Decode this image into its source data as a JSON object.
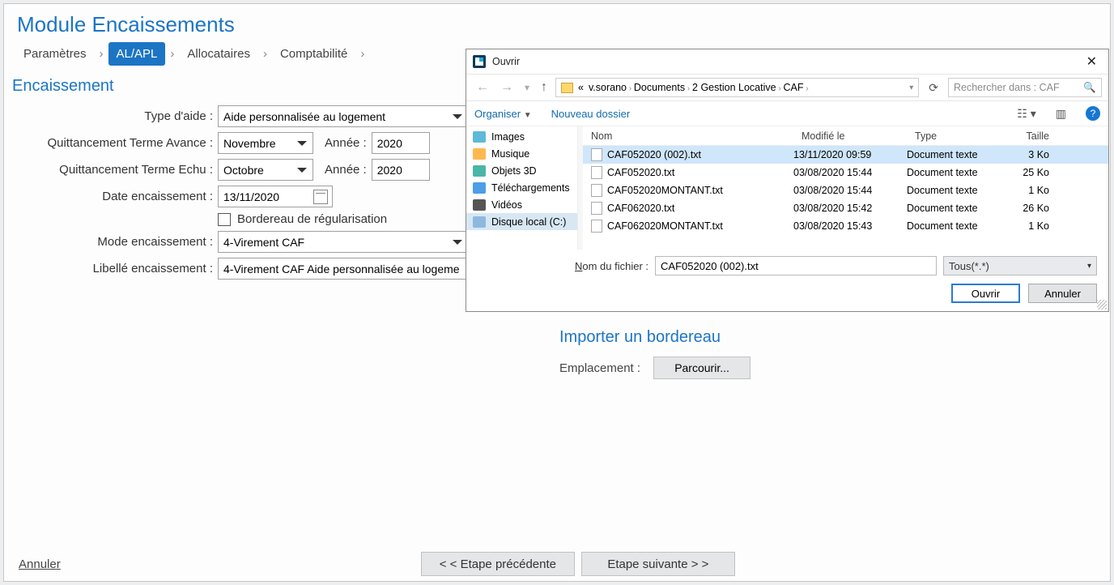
{
  "title": "Module Encaissements",
  "breadcrumbs": [
    "Paramètres",
    "AL/APL",
    "Allocataires",
    "Comptabilité"
  ],
  "active_breadcrumb_index": 1,
  "section_encaissement": "Encaissement",
  "labels": {
    "type_aide": "Type d'aide :",
    "terme_avance": "Quittancement Terme Avance :",
    "terme_echu": "Quittancement Terme Echu :",
    "annee": "Année :",
    "date_enc": "Date encaissement :",
    "bordereau_chk": "Bordereau de régularisation",
    "mode_enc": "Mode encaissement :",
    "libelle_enc": "Libellé encaissement :"
  },
  "values": {
    "type_aide": "Aide personnalisée au logement",
    "terme_avance": "Novembre",
    "annee_avance": "2020",
    "terme_echu": "Octobre",
    "annee_echu": "2020",
    "date_enc": "13/11/2020",
    "mode_enc": "4-Virement CAF",
    "libelle_enc": "4-Virement CAF Aide personnalisée au logeme"
  },
  "import_section": "Importer un bordereau",
  "import_label": "Emplacement :",
  "browse_btn": "Parcourir...",
  "footer": {
    "cancel": "Annuler",
    "prev": "< <  Etape précédente",
    "next": "Etape suivante  > >"
  },
  "dialog": {
    "title": "Ouvrir",
    "path_segments": [
      "v.sorano",
      "Documents",
      "2 Gestion Locative",
      "CAF"
    ],
    "path_prefix": "«",
    "search_placeholder": "Rechercher dans : CAF",
    "organize": "Organiser",
    "new_folder": "Nouveau dossier",
    "tree": [
      "Images",
      "Musique",
      "Objets 3D",
      "Téléchargements",
      "Vidéos",
      "Disque local (C:)"
    ],
    "columns": {
      "name": "Nom",
      "modified": "Modifié le",
      "type": "Type",
      "size": "Taille"
    },
    "files": [
      {
        "name": "CAF052020 (002).txt",
        "modified": "13/11/2020 09:59",
        "type": "Document texte",
        "size": "3 Ko",
        "selected": true
      },
      {
        "name": "CAF052020.txt",
        "modified": "03/08/2020 15:44",
        "type": "Document texte",
        "size": "25 Ko"
      },
      {
        "name": "CAF052020MONTANT.txt",
        "modified": "03/08/2020 15:44",
        "type": "Document texte",
        "size": "1 Ko"
      },
      {
        "name": "CAF062020.txt",
        "modified": "03/08/2020 15:42",
        "type": "Document texte",
        "size": "26 Ko"
      },
      {
        "name": "CAF062020MONTANT.txt",
        "modified": "03/08/2020 15:43",
        "type": "Document texte",
        "size": "1 Ko"
      }
    ],
    "filename_label_pre": "N",
    "filename_label_post": "om du fichier :",
    "filename_value": "CAF052020 (002).txt",
    "filter": "Tous(*.*)",
    "open": "Ouvrir",
    "cancel": "Annuler"
  }
}
